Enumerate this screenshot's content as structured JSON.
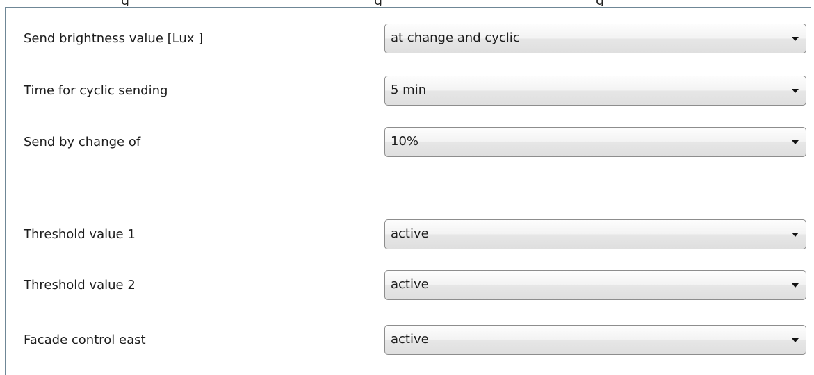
{
  "top_text": {
    "parts": [
      "g",
      "g",
      "g"
    ]
  },
  "rows": [
    {
      "label": "Send brightness value [Lux ]",
      "value": "at change and cyclic"
    },
    {
      "label": "Time for cyclic sending",
      "value": "5 min"
    },
    {
      "label": "Send by change of",
      "value": "10%"
    },
    {
      "label": "Threshold value 1",
      "value": "active"
    },
    {
      "label": "Threshold value 2",
      "value": "active"
    },
    {
      "label": "Facade control east",
      "value": "active"
    }
  ],
  "icons": {
    "dropdown": "chevron-down-icon"
  },
  "colors": {
    "panel_border": "#6f8796",
    "dropdown_border": "#8d8d8d"
  }
}
